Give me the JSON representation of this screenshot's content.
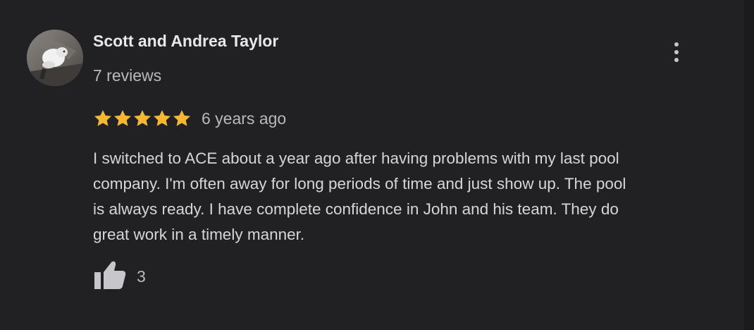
{
  "review": {
    "reviewer_name": "Scott and Andrea Taylor",
    "review_count": "7 reviews",
    "rating": 5,
    "rating_max": 5,
    "age": "6 years ago",
    "text": "I switched to ACE about a year ago after having problems with my last pool\ncompany. I'm often away for long periods of time and just show up. The pool\nis always ready. I have complete confidence in John and his team.  They do\ngreat work in a timely manner.",
    "like_count": "3"
  },
  "icons": {
    "more": "more-vert-icon",
    "star": "star-icon",
    "like": "thumb-up-icon"
  },
  "colors": {
    "background": "#212124",
    "star": "#f5b731",
    "primary_text": "#e8e8ea",
    "secondary_text": "#b9b9bd",
    "icon": "#c7c7cb"
  }
}
